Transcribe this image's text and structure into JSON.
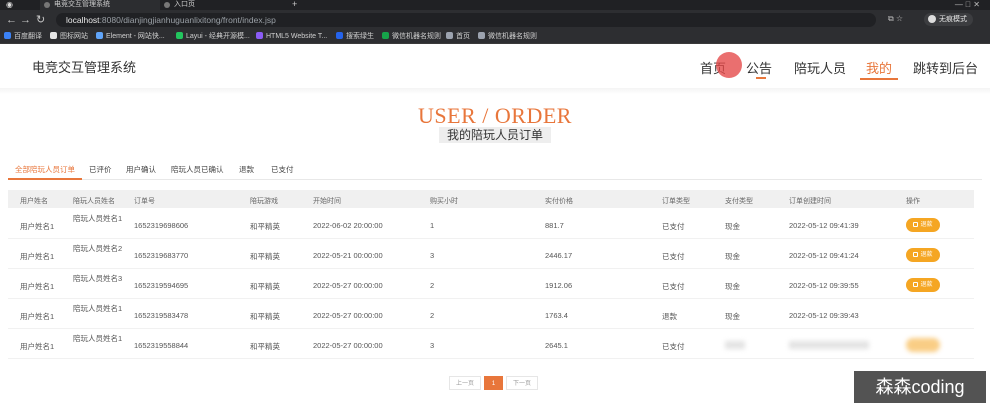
{
  "browser": {
    "tabs": [
      {
        "title": "电竞交互管理系统"
      },
      {
        "title": "入口页"
      }
    ],
    "new_tab": "+",
    "window_controls": "—   ⃞   ✕",
    "url_host": "localhost",
    "url_path": ":8080/dianjingjianhuguanlixitong/front/index.jsp",
    "profile_label": "无痕模式",
    "bookmarks": [
      {
        "label": "百度翻译",
        "color": "#3b82f6"
      },
      {
        "label": "图标网站",
        "color": "#e5e5e5"
      },
      {
        "label": "Element - 网站快...",
        "color": "#60a5fa"
      },
      {
        "label": "Layui - 经典开源模...",
        "color": "#22c55e"
      },
      {
        "label": "HTML5 Website T...",
        "color": "#8b5cf6"
      },
      {
        "label": "搜索绿生",
        "color": "#2563eb"
      },
      {
        "label": "微信机器名规则",
        "color": "#16a34a"
      },
      {
        "label": "首页",
        "color": "#9ca3af"
      },
      {
        "label": "微信机器名规则",
        "color": "#9ca3af"
      }
    ]
  },
  "site": {
    "title": "电竞交互管理系统",
    "nav": [
      {
        "label": "首页"
      },
      {
        "label": "公告"
      },
      {
        "label": "陪玩人员"
      },
      {
        "label": "我的"
      },
      {
        "label": "跳转到后台"
      }
    ],
    "active_nav": "我的",
    "accent_color": "#e8763b"
  },
  "heading": {
    "en": "USER / ORDER",
    "cn": "我的陪玩人员订单"
  },
  "subtabs": [
    {
      "label": "全部陪玩人员订单"
    },
    {
      "label": "已评价"
    },
    {
      "label": "用户确认"
    },
    {
      "label": "陪玩人员已确认"
    },
    {
      "label": "退款"
    },
    {
      "label": "已支付"
    }
  ],
  "table": {
    "columns": [
      "用户姓名",
      "陪玩人员姓名",
      "订单号",
      "陪玩游戏",
      "开始时间",
      "购买小时",
      "实付价格",
      "订单类型",
      "支付类型",
      "订单创建时间",
      "操作"
    ],
    "rows": [
      {
        "user": "用户姓名1",
        "player": "陪玩人员姓名1",
        "order_no": "1652319698606",
        "game": "和平精英",
        "start": "2022-06-02 20:00:00",
        "hours": "1",
        "price": "881.7",
        "status": "已支付",
        "pay": "现金",
        "created": "2022-05-12 09:41:39",
        "action": "退款"
      },
      {
        "user": "用户姓名1",
        "player": "陪玩人员姓名2",
        "order_no": "1652319683770",
        "game": "和平精英",
        "start": "2022-05-21 00:00:00",
        "hours": "3",
        "price": "2446.17",
        "status": "已支付",
        "pay": "现金",
        "created": "2022-05-12 09:41:24",
        "action": "退款"
      },
      {
        "user": "用户姓名1",
        "player": "陪玩人员姓名3",
        "order_no": "1652319594695",
        "game": "和平精英",
        "start": "2022-05-27 00:00:00",
        "hours": "2",
        "price": "1912.06",
        "status": "已支付",
        "pay": "现金",
        "created": "2022-05-12 09:39:55",
        "action": "退款"
      },
      {
        "user": "用户姓名1",
        "player": "陪玩人员姓名1",
        "order_no": "1652319583478",
        "game": "和平精英",
        "start": "2022-05-27 00:00:00",
        "hours": "2",
        "price": "1763.4",
        "status": "退款",
        "pay": "现金",
        "created": "2022-05-12 09:39:43",
        "action": ""
      },
      {
        "user": "用户姓名1",
        "player": "陪玩人员姓名1",
        "order_no": "1652319558844",
        "game": "和平精英",
        "start": "2022-05-27 00:00:00",
        "hours": "3",
        "price": "2645.1",
        "status": "已支付",
        "pay": "",
        "created": "",
        "action": ""
      }
    ]
  },
  "pagination": {
    "prev": "上一页",
    "current": "1",
    "next": "下一页"
  },
  "watermark": "森森coding"
}
